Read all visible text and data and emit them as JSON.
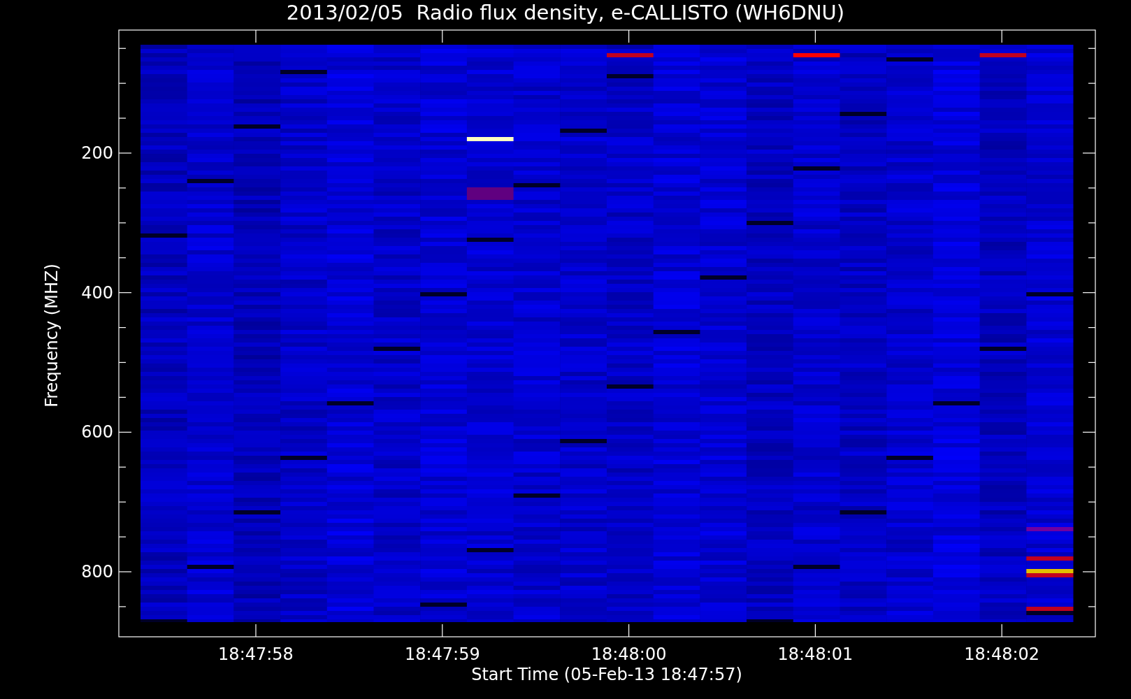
{
  "title": "2013/02/05  Radio flux density, e-CALLISTO (WH6DNU)",
  "ylabel": "Frequency (MHZ)",
  "xlabel": "Start Time (05-Feb-13 18:47:57)",
  "yticks": [
    "200",
    "400",
    "600",
    "800"
  ],
  "xticks": [
    "18:47:58",
    "18:47:59",
    "18:48:00",
    "18:48:01",
    "18:48:02"
  ]
}
